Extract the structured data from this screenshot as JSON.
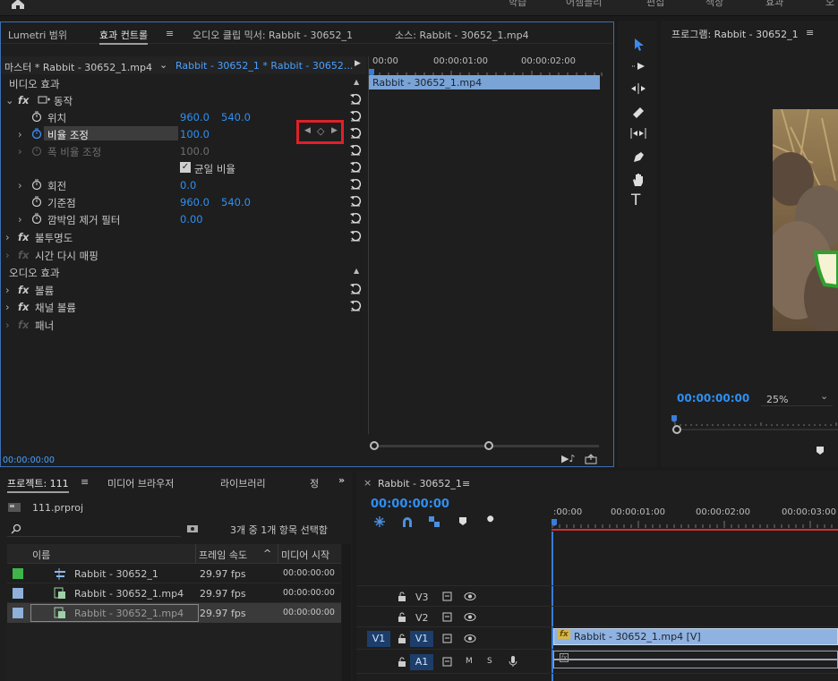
{
  "top": {
    "workspaces": [
      "학습",
      "어셈블리",
      "편집",
      "색상",
      "효과",
      "오"
    ]
  },
  "effect_controls": {
    "tabs": [
      "Lumetri 범위",
      "효과 컨트롤",
      "≡",
      "오디오 클립 믹서: Rabbit - 30652_1",
      "소스: Rabbit - 30652_1.mp4"
    ],
    "master_label": "마스터 * Rabbit - 30652_1.mp4",
    "sequence_label": "Rabbit - 30652_1 * Rabbit - 30652...",
    "ruler": [
      "00:00",
      "00:00:01:00",
      "00:00:02:00"
    ],
    "clip_label": "Rabbit - 30652_1.mp4",
    "video_header": "비디오 효과",
    "motion": "동작",
    "position_label": "위치",
    "position_x": "960.0",
    "position_y": "540.0",
    "scale_label": "비율 조정",
    "scale_value": "100.0",
    "width_scale_label": "폭 비율 조정",
    "width_scale_value": "100.0",
    "uniform_label": "균일 비율",
    "rotation_label": "회전",
    "rotation_value": "0.0",
    "anchor_label": "기준점",
    "anchor_x": "960.0",
    "anchor_y": "540.0",
    "flicker_label": "깜박임 제거 필터",
    "flicker_value": "0.00",
    "opacity_label": "불투명도",
    "remap_label": "시간 다시 매핑",
    "audio_header": "오디오 효과",
    "volume_label": "볼륨",
    "channel_volume_label": "채널 볼륨",
    "panner_label": "패너",
    "timecode": "00:00:00:00"
  },
  "program": {
    "title": "프로그램: Rabbit - 30652_1",
    "menu": "≡",
    "timecode": "00:00:00:00",
    "zoom": "25%"
  },
  "project": {
    "tabs": [
      "프로젝트: 111",
      "≡",
      "미디어 브라우저",
      "라이브러리",
      "정",
      "»"
    ],
    "file": "111.prproj",
    "selection_info": "3개 중 1개 항목 선택함",
    "columns": [
      "이름",
      "프레임 속도",
      "미디어 시작"
    ],
    "items": [
      {
        "name": "Rabbit - 30652_1",
        "fps": "29.97 fps",
        "start": "00:00:00:00",
        "color": "#3fb54a"
      },
      {
        "name": "Rabbit - 30652_1.mp4",
        "fps": "29.97 fps",
        "start": "00:00:00:00",
        "color": "#8fb0d9"
      },
      {
        "name": "Rabbit - 30652_1.mp4",
        "fps": "29.97 fps",
        "start": "00:00:00:00",
        "color": "#8fb0d9"
      }
    ]
  },
  "timeline": {
    "title": "Rabbit - 30652_1",
    "menu": "≡",
    "close": "×",
    "timecode": "00:00:00:00",
    "ruler": [
      ":00:00",
      "00:00:01:00",
      "00:00:02:00",
      "00:00:03:00"
    ],
    "tracks": {
      "v3": "V3",
      "v2": "V2",
      "v1": "V1",
      "v1_source": "V1",
      "a1": "A1",
      "a1_source": "A1",
      "m": "M",
      "s": "S"
    },
    "clip_label": "Rabbit - 30652_1.mp4 [V]",
    "fx": "fx"
  },
  "tools": [
    "selection-tool",
    "track-select-tool",
    "ripple-edit-tool",
    "razor-tool",
    "slip-tool",
    "pen-tool",
    "hand-tool",
    "type-tool"
  ],
  "colors": {
    "accent": "#2f8ff2",
    "playhead": "#3a7dd8",
    "highlight": "#e0202a"
  }
}
